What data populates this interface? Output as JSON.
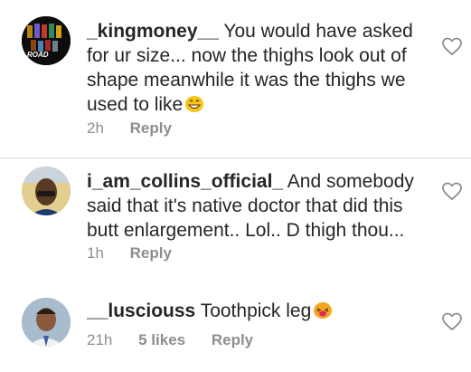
{
  "comments": [
    {
      "username": "_kingmoney__",
      "text": "You would have asked for ur size... now the thighs look out of shape meanwhile it was the thighs we used to like",
      "emoji": "grinning-face-emoji",
      "time": "2h",
      "likes": "",
      "reply_label": "Reply",
      "avatar_text": "ROAD"
    },
    {
      "username": "i_am_collins_official_",
      "text": "And somebody said that it's native doctor that did this butt enlargement.. Lol.. D thigh thou...",
      "emoji": "",
      "time": "1h",
      "likes": "",
      "reply_label": "Reply",
      "avatar_text": ""
    },
    {
      "username": "__lusciouss",
      "text": "Toothpick leg",
      "emoji": "tongue-out-face-emoji",
      "time": "21h",
      "likes": "5 likes",
      "reply_label": "Reply",
      "avatar_text": ""
    }
  ],
  "colors": {
    "text": "#262626",
    "meta": "#8e8e8e",
    "divider": "#dbdbdb",
    "heart": "#8e8e8e"
  }
}
